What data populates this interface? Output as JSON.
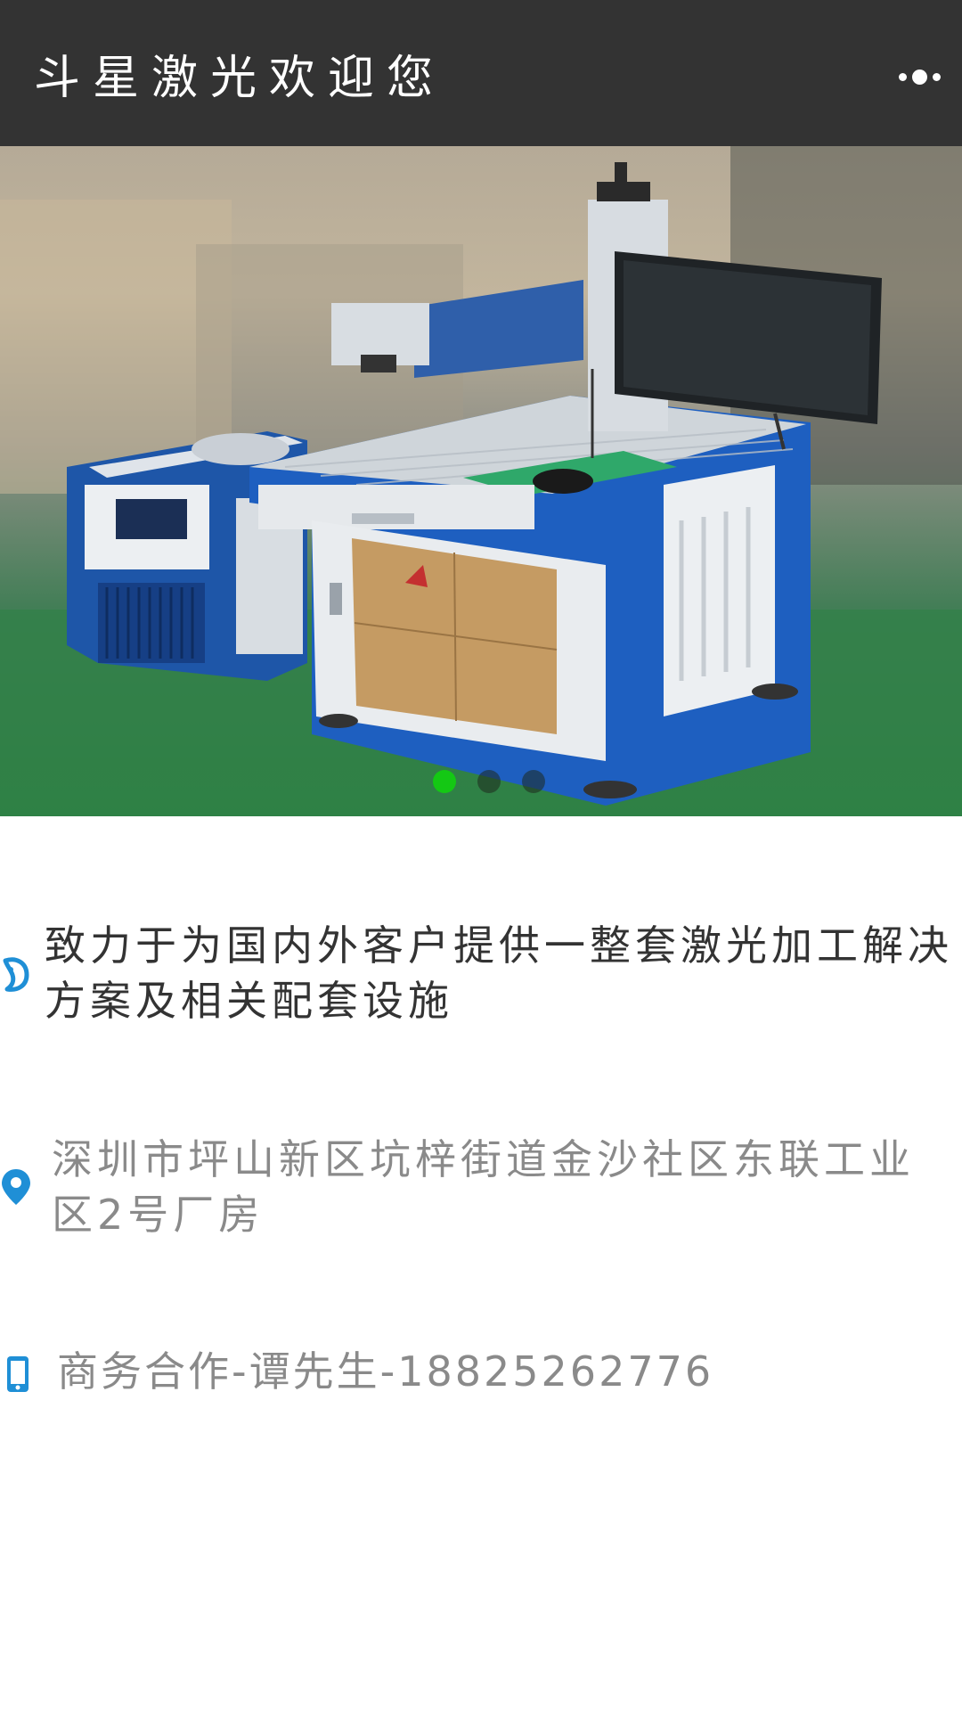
{
  "header": {
    "title": "斗星激光欢迎您",
    "menu_icon": "more-dots-icon"
  },
  "banner": {
    "image_alt": "laser-marking-machine-photo",
    "slide_count": 3,
    "active_slide": 1
  },
  "info": {
    "slogan": "致力于为国内外客户提供一整套激光加工解决方案及相关配套设施",
    "address": "深圳市坪山新区坑梓街道金沙社区东联工业区2号厂房",
    "phone": "商务合作-谭先生-18825262776"
  },
  "icons": {
    "slogan": "chat-bubble-icon",
    "address": "location-pin-icon",
    "phone": "mobile-phone-icon"
  },
  "colors": {
    "header_bg": "#333333",
    "icon_blue": "#1f8fd6",
    "active_dot": "#14c814",
    "slogan_text": "#333333",
    "secondary_text": "#8a8a8a"
  }
}
